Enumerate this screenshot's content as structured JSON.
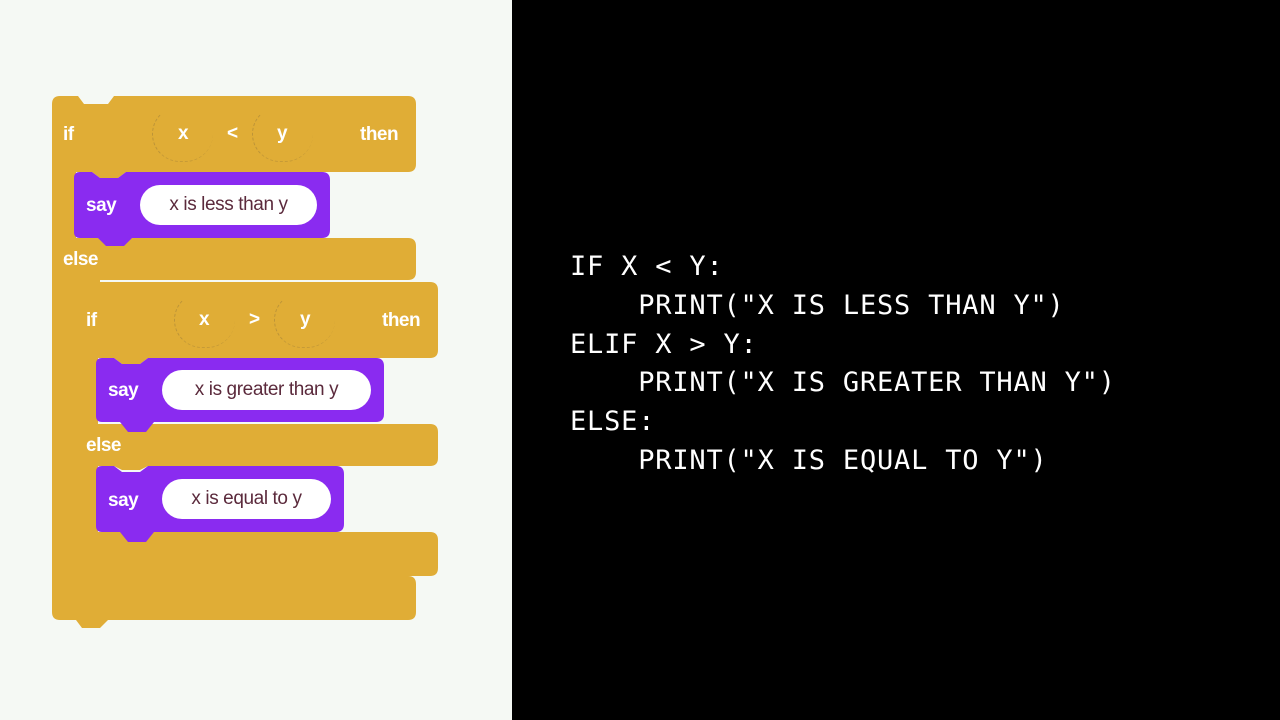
{
  "blocks": {
    "outer_if": {
      "if_label": "if",
      "var_a": "x",
      "operator": "<",
      "var_b": "y",
      "then_label": "then",
      "say_label": "say",
      "say_text": "x is less than y",
      "else_label": "else"
    },
    "inner_if": {
      "if_label": "if",
      "var_a": "x",
      "operator": ">",
      "var_b": "y",
      "then_label": "then",
      "say_label": "say",
      "say_text": "x is greater than y",
      "else_label": "else",
      "else_say_label": "say",
      "else_say_text": "x is equal to y"
    },
    "colors": {
      "control": "#e0ad36",
      "looks": "#8a2bf0",
      "left_background": "#f5f9f4",
      "right_background": "#000000"
    }
  },
  "code": {
    "lines": [
      "IF X < Y:",
      "    PRINT(\"X IS LESS THAN Y\")",
      "ELIF X > Y:",
      "    PRINT(\"X IS GREATER THAN Y\")",
      "ELSE:",
      "    PRINT(\"X IS EQUAL TO Y\")"
    ]
  }
}
